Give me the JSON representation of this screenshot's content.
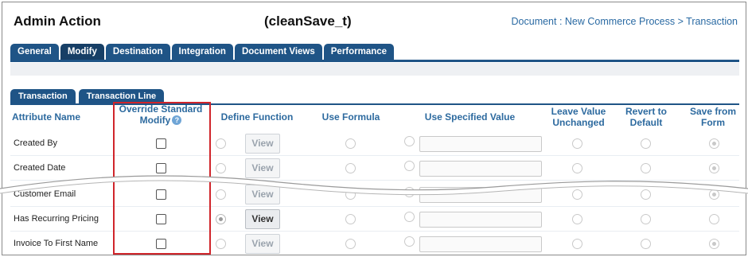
{
  "header": {
    "title": "Admin Action",
    "action_name": "(cleanSave_t)",
    "breadcrumb": "Document : New Commerce Process > Transaction"
  },
  "tabs": [
    "General",
    "Modify",
    "Destination",
    "Integration",
    "Document Views",
    "Performance"
  ],
  "active_tab": "Modify",
  "subtabs": [
    "Transaction",
    "Transaction Line"
  ],
  "columns": {
    "attribute_name": "Attribute Name",
    "override_line1": "Override Standard",
    "override_line2": "Modify",
    "define_function": "Define Function",
    "use_formula": "Use Formula",
    "use_specified_value": "Use Specified Value",
    "leave_unchanged_line1": "Leave Value",
    "leave_unchanged_line2": "Unchanged",
    "revert_line1": "Revert to",
    "revert_line2": "Default",
    "save_from_form_line1": "Save from",
    "save_from_form_line2": "Form"
  },
  "view_label": "View",
  "rows": [
    {
      "label": "Created By",
      "override_checked": false,
      "view_enabled": false,
      "selected": "save_from_form"
    },
    {
      "label": "Created Date",
      "override_checked": false,
      "view_enabled": false,
      "selected": "save_from_form"
    },
    {
      "label": "Customer Email",
      "override_checked": false,
      "view_enabled": false,
      "selected": "save_from_form"
    },
    {
      "label": "Has Recurring Pricing",
      "override_checked": false,
      "view_enabled": true,
      "selected": "define_function"
    },
    {
      "label": "Invoice To First Name",
      "override_checked": false,
      "view_enabled": false,
      "selected": "save_from_form"
    }
  ],
  "icons": {
    "help": "question-mark-icon"
  },
  "colors": {
    "tab": "#1f5486",
    "header_text": "#2d6a9f",
    "highlight": "#d0252b"
  }
}
